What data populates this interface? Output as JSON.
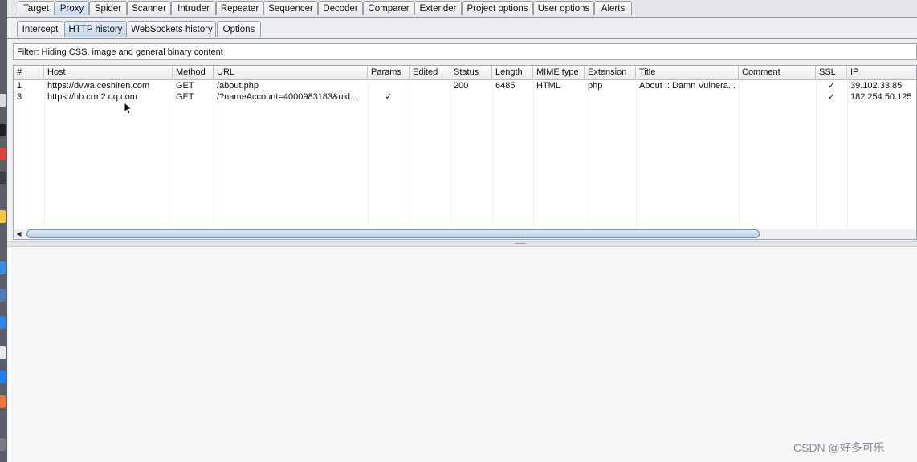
{
  "main_tabs": [
    {
      "label": "Target",
      "active": false
    },
    {
      "label": "Proxy",
      "active": true
    },
    {
      "label": "Spider",
      "active": false
    },
    {
      "label": "Scanner",
      "active": false
    },
    {
      "label": "Intruder",
      "active": false
    },
    {
      "label": "Repeater",
      "active": false
    },
    {
      "label": "Sequencer",
      "active": false
    },
    {
      "label": "Decoder",
      "active": false
    },
    {
      "label": "Comparer",
      "active": false
    },
    {
      "label": "Extender",
      "active": false
    },
    {
      "label": "Project options",
      "active": false
    },
    {
      "label": "User options",
      "active": false
    },
    {
      "label": "Alerts",
      "active": false
    }
  ],
  "proxy_tabs": [
    {
      "label": "Intercept",
      "active": false
    },
    {
      "label": "HTTP history",
      "active": true
    },
    {
      "label": "WebSockets history",
      "active": false
    },
    {
      "label": "Options",
      "active": false
    }
  ],
  "filter": {
    "text": "Filter: Hiding CSS, image and general binary content"
  },
  "table": {
    "columns": [
      "#",
      "Host",
      "Method",
      "URL",
      "Params",
      "Edited",
      "Status",
      "Length",
      "MIME type",
      "Extension",
      "Title",
      "Comment",
      "SSL",
      "IP"
    ],
    "rows": [
      {
        "num": "1",
        "host": "https://dvwa.ceshiren.com",
        "method": "GET",
        "url": "/about.php",
        "params": "",
        "edited": "",
        "status": "200",
        "length": "6485",
        "mime": "HTML",
        "extension": "php",
        "title": "About :: Damn Vulnera...",
        "comment": "",
        "ssl": "✓",
        "ip": "39.102.33.85"
      },
      {
        "num": "3",
        "host": "https://hb.crm2.qq.com",
        "method": "GET",
        "url": "/?nameAccount=4000983183&uid...",
        "params": "✓",
        "edited": "",
        "status": "",
        "length": "",
        "mime": "",
        "extension": "",
        "title": "",
        "comment": "",
        "ssl": "✓",
        "ip": "182.254.50.125"
      }
    ]
  },
  "scrollbar": {
    "left_arrow": "◀"
  },
  "watermark": "CSDN @好多可乐",
  "colors": {
    "active_tab": "#c7daee",
    "scroll_thumb": "#b9cde4",
    "dock": "#5a5e66"
  }
}
